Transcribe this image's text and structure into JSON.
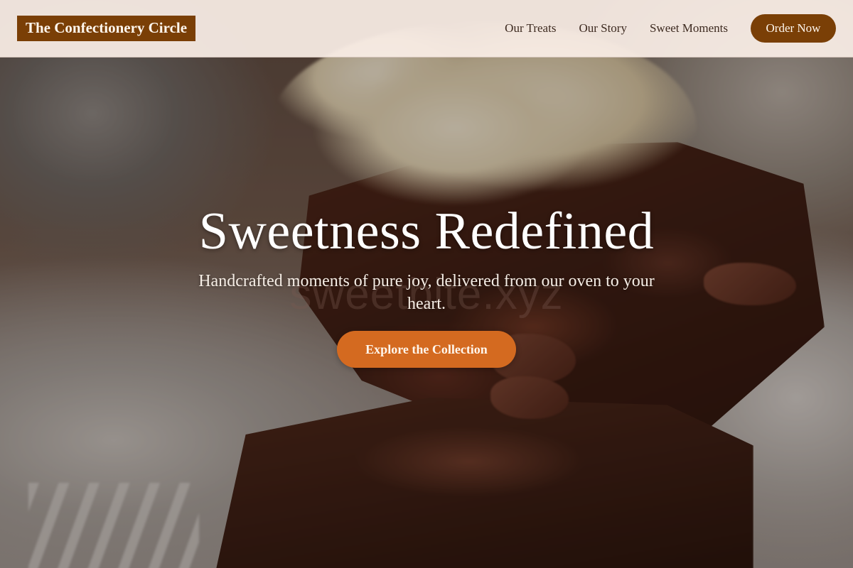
{
  "header": {
    "logo": "The Confectionery Circle",
    "nav": [
      "Our Treats",
      "Our Story",
      "Sweet Moments"
    ],
    "order_button": "Order Now"
  },
  "hero": {
    "title": "Sweetness Redefined",
    "watermark": "sweetbite.xyz",
    "subtitle": "Handcrafted moments of pure joy, delivered from our oven to your heart.",
    "cta": "Explore the Collection",
    "background_image": "chocolate-brownie-with-ice-cream"
  },
  "colors": {
    "brand": "#7a3f06",
    "accent": "#d46a20",
    "header_bg": "#faeee6",
    "nav_text": "#3d2a20"
  }
}
